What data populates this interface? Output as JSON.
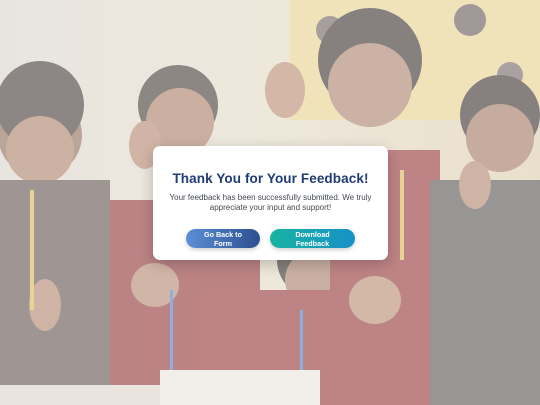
{
  "dialog": {
    "title": "Thank You for Your Feedback!",
    "message": "Your feedback has been successfully submitted. We truly appreciate your input and support!",
    "back_button_label": "Go Back to Form",
    "download_button_label": "Download Feedback"
  },
  "colors": {
    "title": "#1f3c74",
    "back_button_start": "#5b8fd6",
    "back_button_end": "#2c4f8f",
    "download_button_start": "#18b3a3",
    "download_button_end": "#1790c8"
  }
}
